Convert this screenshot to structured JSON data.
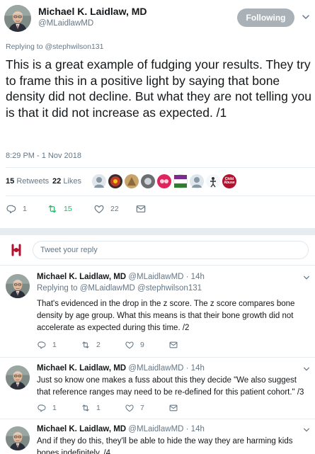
{
  "tweet": {
    "author_name": "Michael K. Laidlaw, MD",
    "author_handle": "@MLaidlawMD",
    "follow_label": "Following",
    "replying_to": "Replying to @stephwilson131",
    "text": "This is a great example of fudging your results. They try to frame this in a positive light by saying that bone density did not decline. But what they are not telling you is that it did not increase as expected. /1",
    "timestamp": "8:29 PM - 1 Nov 2018",
    "retweets_count": "15",
    "retweets_label": "Retweets",
    "likes_count": "22",
    "likes_label": "Likes",
    "actions": {
      "replies": "1",
      "retweets": "15",
      "likes": "22"
    }
  },
  "liker_avatars": [
    "avatar-1",
    "avatar-2",
    "avatar-3",
    "avatar-4",
    "avatar-5",
    "avatar-6",
    "avatar-7",
    "avatar-8",
    "Child Abuse"
  ],
  "compose": {
    "placeholder": "Tweet your reply"
  },
  "replies": [
    {
      "author_name": "Michael K. Laidlaw, MD",
      "author_handle": "@MLaidlawMD · 14h",
      "replying_to": "Replying to @MLaidlawMD @stephwilson131",
      "text": "That's evidenced in the drop in the z score. The z score compares bone density by age group. What this means is that their bone growth did not accelerate as expected during this time. /2",
      "replies": "1",
      "retweets": "2",
      "likes": "9"
    },
    {
      "author_name": "Michael K. Laidlaw, MD",
      "author_handle": "@MLaidlawMD · 14h",
      "text": "Just so know one makes a fuss about this they decide \"We also suggest that reference ranges may need to be re-defined for this patient cohort.\" /3",
      "replies": "1",
      "retweets": "1",
      "likes": "7"
    },
    {
      "author_name": "Michael K. Laidlaw, MD",
      "author_handle": "@MLaidlawMD · 14h",
      "text": "And if they do this, they'll be able to hide the way they are harming kids bones indefinitely. /4"
    }
  ],
  "colors": {
    "text": "#14171a",
    "muted": "#657786",
    "retweet_green": "#17bf63",
    "follow_button": "#aab2b8",
    "divider": "#e6ecf0"
  }
}
